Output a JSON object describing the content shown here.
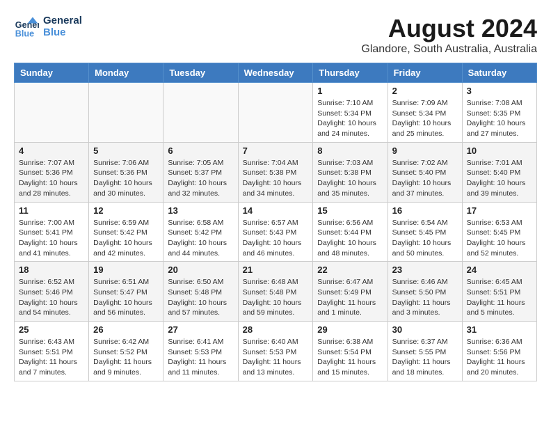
{
  "header": {
    "logo_line1": "General",
    "logo_line2": "Blue",
    "main_title": "August 2024",
    "subtitle": "Glandore, South Australia, Australia"
  },
  "calendar": {
    "days_of_week": [
      "Sunday",
      "Monday",
      "Tuesday",
      "Wednesday",
      "Thursday",
      "Friday",
      "Saturday"
    ],
    "weeks": [
      [
        {
          "day": "",
          "info": ""
        },
        {
          "day": "",
          "info": ""
        },
        {
          "day": "",
          "info": ""
        },
        {
          "day": "",
          "info": ""
        },
        {
          "day": "1",
          "info": "Sunrise: 7:10 AM\nSunset: 5:34 PM\nDaylight: 10 hours\nand 24 minutes."
        },
        {
          "day": "2",
          "info": "Sunrise: 7:09 AM\nSunset: 5:34 PM\nDaylight: 10 hours\nand 25 minutes."
        },
        {
          "day": "3",
          "info": "Sunrise: 7:08 AM\nSunset: 5:35 PM\nDaylight: 10 hours\nand 27 minutes."
        }
      ],
      [
        {
          "day": "4",
          "info": "Sunrise: 7:07 AM\nSunset: 5:36 PM\nDaylight: 10 hours\nand 28 minutes."
        },
        {
          "day": "5",
          "info": "Sunrise: 7:06 AM\nSunset: 5:36 PM\nDaylight: 10 hours\nand 30 minutes."
        },
        {
          "day": "6",
          "info": "Sunrise: 7:05 AM\nSunset: 5:37 PM\nDaylight: 10 hours\nand 32 minutes."
        },
        {
          "day": "7",
          "info": "Sunrise: 7:04 AM\nSunset: 5:38 PM\nDaylight: 10 hours\nand 34 minutes."
        },
        {
          "day": "8",
          "info": "Sunrise: 7:03 AM\nSunset: 5:38 PM\nDaylight: 10 hours\nand 35 minutes."
        },
        {
          "day": "9",
          "info": "Sunrise: 7:02 AM\nSunset: 5:40 PM\nDaylight: 10 hours\nand 37 minutes."
        },
        {
          "day": "10",
          "info": "Sunrise: 7:01 AM\nSunset: 5:40 PM\nDaylight: 10 hours\nand 39 minutes."
        }
      ],
      [
        {
          "day": "11",
          "info": "Sunrise: 7:00 AM\nSunset: 5:41 PM\nDaylight: 10 hours\nand 41 minutes."
        },
        {
          "day": "12",
          "info": "Sunrise: 6:59 AM\nSunset: 5:42 PM\nDaylight: 10 hours\nand 42 minutes."
        },
        {
          "day": "13",
          "info": "Sunrise: 6:58 AM\nSunset: 5:42 PM\nDaylight: 10 hours\nand 44 minutes."
        },
        {
          "day": "14",
          "info": "Sunrise: 6:57 AM\nSunset: 5:43 PM\nDaylight: 10 hours\nand 46 minutes."
        },
        {
          "day": "15",
          "info": "Sunrise: 6:56 AM\nSunset: 5:44 PM\nDaylight: 10 hours\nand 48 minutes."
        },
        {
          "day": "16",
          "info": "Sunrise: 6:54 AM\nSunset: 5:45 PM\nDaylight: 10 hours\nand 50 minutes."
        },
        {
          "day": "17",
          "info": "Sunrise: 6:53 AM\nSunset: 5:45 PM\nDaylight: 10 hours\nand 52 minutes."
        }
      ],
      [
        {
          "day": "18",
          "info": "Sunrise: 6:52 AM\nSunset: 5:46 PM\nDaylight: 10 hours\nand 54 minutes."
        },
        {
          "day": "19",
          "info": "Sunrise: 6:51 AM\nSunset: 5:47 PM\nDaylight: 10 hours\nand 56 minutes."
        },
        {
          "day": "20",
          "info": "Sunrise: 6:50 AM\nSunset: 5:48 PM\nDaylight: 10 hours\nand 57 minutes."
        },
        {
          "day": "21",
          "info": "Sunrise: 6:48 AM\nSunset: 5:48 PM\nDaylight: 10 hours\nand 59 minutes."
        },
        {
          "day": "22",
          "info": "Sunrise: 6:47 AM\nSunset: 5:49 PM\nDaylight: 11 hours\nand 1 minute."
        },
        {
          "day": "23",
          "info": "Sunrise: 6:46 AM\nSunset: 5:50 PM\nDaylight: 11 hours\nand 3 minutes."
        },
        {
          "day": "24",
          "info": "Sunrise: 6:45 AM\nSunset: 5:51 PM\nDaylight: 11 hours\nand 5 minutes."
        }
      ],
      [
        {
          "day": "25",
          "info": "Sunrise: 6:43 AM\nSunset: 5:51 PM\nDaylight: 11 hours\nand 7 minutes."
        },
        {
          "day": "26",
          "info": "Sunrise: 6:42 AM\nSunset: 5:52 PM\nDaylight: 11 hours\nand 9 minutes."
        },
        {
          "day": "27",
          "info": "Sunrise: 6:41 AM\nSunset: 5:53 PM\nDaylight: 11 hours\nand 11 minutes."
        },
        {
          "day": "28",
          "info": "Sunrise: 6:40 AM\nSunset: 5:53 PM\nDaylight: 11 hours\nand 13 minutes."
        },
        {
          "day": "29",
          "info": "Sunrise: 6:38 AM\nSunset: 5:54 PM\nDaylight: 11 hours\nand 15 minutes."
        },
        {
          "day": "30",
          "info": "Sunrise: 6:37 AM\nSunset: 5:55 PM\nDaylight: 11 hours\nand 18 minutes."
        },
        {
          "day": "31",
          "info": "Sunrise: 6:36 AM\nSunset: 5:56 PM\nDaylight: 11 hours\nand 20 minutes."
        }
      ]
    ]
  }
}
